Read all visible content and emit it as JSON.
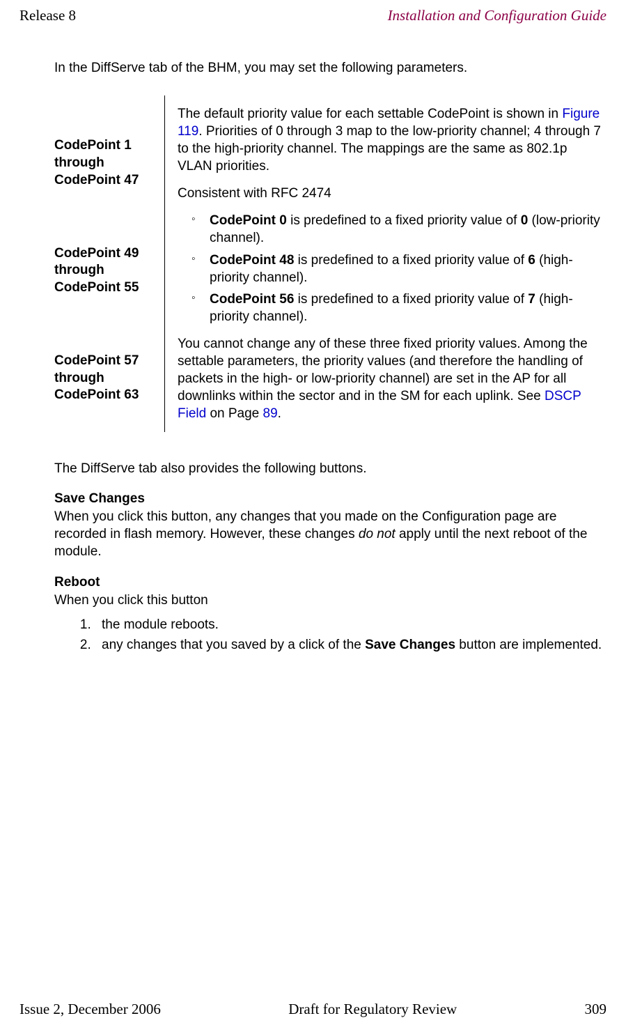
{
  "header": {
    "left": "Release 8",
    "right": "Installation and Configuration Guide"
  },
  "footer": {
    "left": "Issue 2, December 2006",
    "center": "Draft for Regulatory Review",
    "right": "309"
  },
  "intro": "In the DiffServe tab of the BHM, you may set the following parameters.",
  "labels": {
    "l1a": "CodePoint 1",
    "l1b": "through",
    "l1c": "CodePoint 47",
    "l2a": "CodePoint 49",
    "l2b": "through",
    "l2c": "CodePoint 55",
    "l3a": "CodePoint 57",
    "l3b": "through",
    "l3c": "CodePoint 63"
  },
  "desc": {
    "p1a": "The default priority value for each settable CodePoint is shown in ",
    "p1link": "Figure 119",
    "p1b": ". Priorities of 0 through 3 map to the low-priority channel; 4 through 7 to the high-priority channel. The mappings are the same as 802.1p VLAN priorities.",
    "p2": "Consistent with RFC 2474",
    "b1s": "CodePoint 0",
    "b1m": " is predefined to a fixed priority value of ",
    "b1n": "0",
    "b1e": " (low-priority channel).",
    "b2s": "CodePoint 48",
    "b2m": " is predefined to a fixed priority value of ",
    "b2n": "6",
    "b2e": " (high-priority channel).",
    "b3s": "CodePoint 56",
    "b3m": " is predefined to a fixed priority value of ",
    "b3n": "7",
    "b3e": " (high-priority channel).",
    "p3a": "You cannot change any of these three fixed priority values. Among the settable parameters, the priority values (and therefore the handling of packets in the high- or low-priority channel) are set in the AP for all downlinks within the sector and in the SM for each uplink. See ",
    "p3link1": "DSCP Field",
    "p3b": " on Page ",
    "p3link2": "89",
    "p3c": "."
  },
  "after": {
    "intro2": "The DiffServe tab also provides the following buttons.",
    "h1": "Save Changes",
    "p1a": "When you click this button, any changes that you made on the Configuration page are recorded in flash memory. However, these changes ",
    "p1em": "do not",
    "p1b": " apply until the next reboot of the module.",
    "h2": "Reboot",
    "p2": "When you click this button",
    "li1": "the module reboots.",
    "li2a": "any changes that you saved by a click of the ",
    "li2s": "Save Changes",
    "li2b": " button are implemented."
  }
}
